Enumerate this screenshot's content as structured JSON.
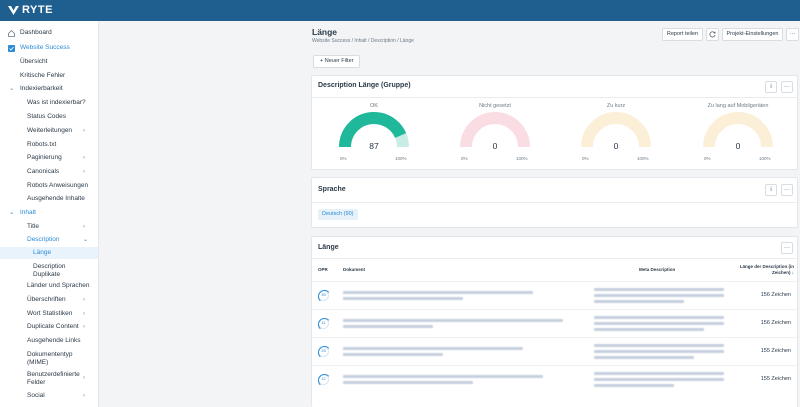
{
  "app": {
    "brand": "RYTE",
    "accent": "#2b8bd6",
    "topbar_color": "#1f5f8f"
  },
  "sidebar": {
    "items": [
      {
        "label": "Dashboard",
        "icon": "home-icon"
      },
      {
        "label": "Website Success",
        "icon": "website-success-icon"
      },
      {
        "label": "Übersicht"
      },
      {
        "label": "Kritische Fehler"
      },
      {
        "label": "Indexierbarkeit"
      },
      {
        "label": "Was ist indexierbar?"
      },
      {
        "label": "Status Codes"
      },
      {
        "label": "Weiterleitungen"
      },
      {
        "label": "Robots.txt"
      },
      {
        "label": "Paginierung"
      },
      {
        "label": "Canonicals"
      },
      {
        "label": "Robots Anweisungen"
      },
      {
        "label": "Ausgehende Inhalte"
      },
      {
        "label": "Inhalt"
      },
      {
        "label": "Title"
      },
      {
        "label": "Description"
      },
      {
        "label": "Länge"
      },
      {
        "label": "Description Duplikate"
      },
      {
        "label": "Länder und Sprachen"
      },
      {
        "label": "Überschriften"
      },
      {
        "label": "Wort Statistiken"
      },
      {
        "label": "Duplicate Content"
      },
      {
        "label": "Ausgehende Links"
      },
      {
        "label": "Dokumententyp (MIME)"
      },
      {
        "label": "Benutzerdefinierte Felder"
      },
      {
        "label": "Social"
      }
    ]
  },
  "header": {
    "title": "Länge",
    "breadcrumb": "Website Success / Inhalt / Description / Länge",
    "report_button": "Report teilen",
    "settings_button": "Projekt-Einstellungen",
    "more": "···"
  },
  "filter": {
    "label": "Neuer Filter"
  },
  "group_card": {
    "title": "Description Länge (Gruppe)",
    "gauges": [
      {
        "label": "OK",
        "value": "87",
        "fraction": 0.87,
        "color": "#1fb89a",
        "track": "#1fb89a",
        "min": "0%",
        "max": "100%"
      },
      {
        "label": "Nicht gesetzt",
        "value": "0",
        "fraction": 0,
        "color": "#f4b3c0",
        "track": "#f9dde3",
        "min": "0%",
        "max": "100%"
      },
      {
        "label": "Zu kurz",
        "value": "0",
        "fraction": 0,
        "color": "#f6dcae",
        "track": "#fcefd8",
        "min": "0%",
        "max": "100%"
      },
      {
        "label": "Zu lang auf Mobilgeräten",
        "value": "0",
        "fraction": 0,
        "color": "#f6dcae",
        "track": "#fcefd8",
        "min": "0%",
        "max": "100%"
      }
    ]
  },
  "language_card": {
    "title": "Sprache",
    "chip": "Deutsch (90)"
  },
  "table_card": {
    "title": "Länge",
    "columns": {
      "opr": "OPR",
      "document": "Dokument",
      "meta": "Meta Description",
      "length": "Länge der Description (in Zeichen)"
    },
    "rows": [
      {
        "opr": "35",
        "length": "156 Zeichen"
      },
      {
        "opr": "11",
        "length": "156 Zeichen"
      },
      {
        "opr": "25",
        "length": "155 Zeichen"
      },
      {
        "opr": "12",
        "length": "155 Zeichen"
      }
    ]
  }
}
